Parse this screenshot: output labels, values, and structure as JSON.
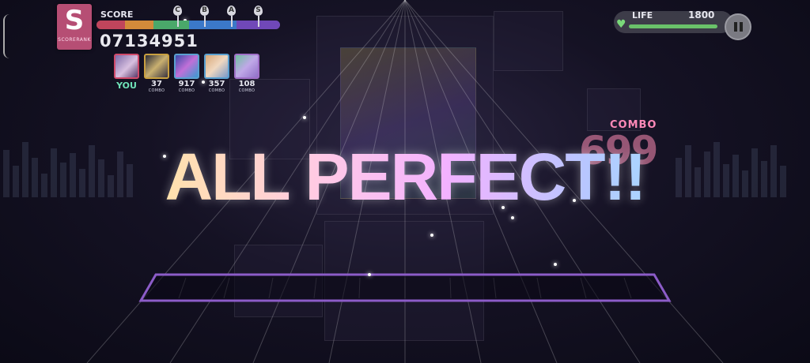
{
  "hud": {
    "rank": {
      "letter": "S",
      "subtitle": "SCORERANK"
    },
    "score": {
      "label": "SCORE",
      "value": "07134951",
      "rank_ticks": [
        "C",
        "B",
        "A",
        "S"
      ]
    },
    "players": [
      {
        "label": "YOU",
        "combo_caption": ""
      },
      {
        "count": "37",
        "combo_caption": "COMBO"
      },
      {
        "count": "917",
        "combo_caption": "COMBO"
      },
      {
        "count": "357",
        "combo_caption": "COMBO"
      },
      {
        "count": "108",
        "combo_caption": "COMBO"
      }
    ],
    "life": {
      "label": "LIFE",
      "value": "1800"
    },
    "combo": {
      "label": "COMBO",
      "value": "699"
    }
  },
  "result": {
    "text": "ALL PERFECT!!"
  },
  "colors": {
    "rank_badge": "#b64e74",
    "life_bar": "#6ac26a",
    "you_label": "#6fe3b8",
    "lane_frame": "#8c5cc8",
    "score_segments": [
      "#c0455c",
      "#d28a3a",
      "#4aa86a",
      "#3b78c8",
      "#7048b8"
    ]
  },
  "icons": {
    "life": "heart-icon",
    "pause": "pause-icon"
  }
}
